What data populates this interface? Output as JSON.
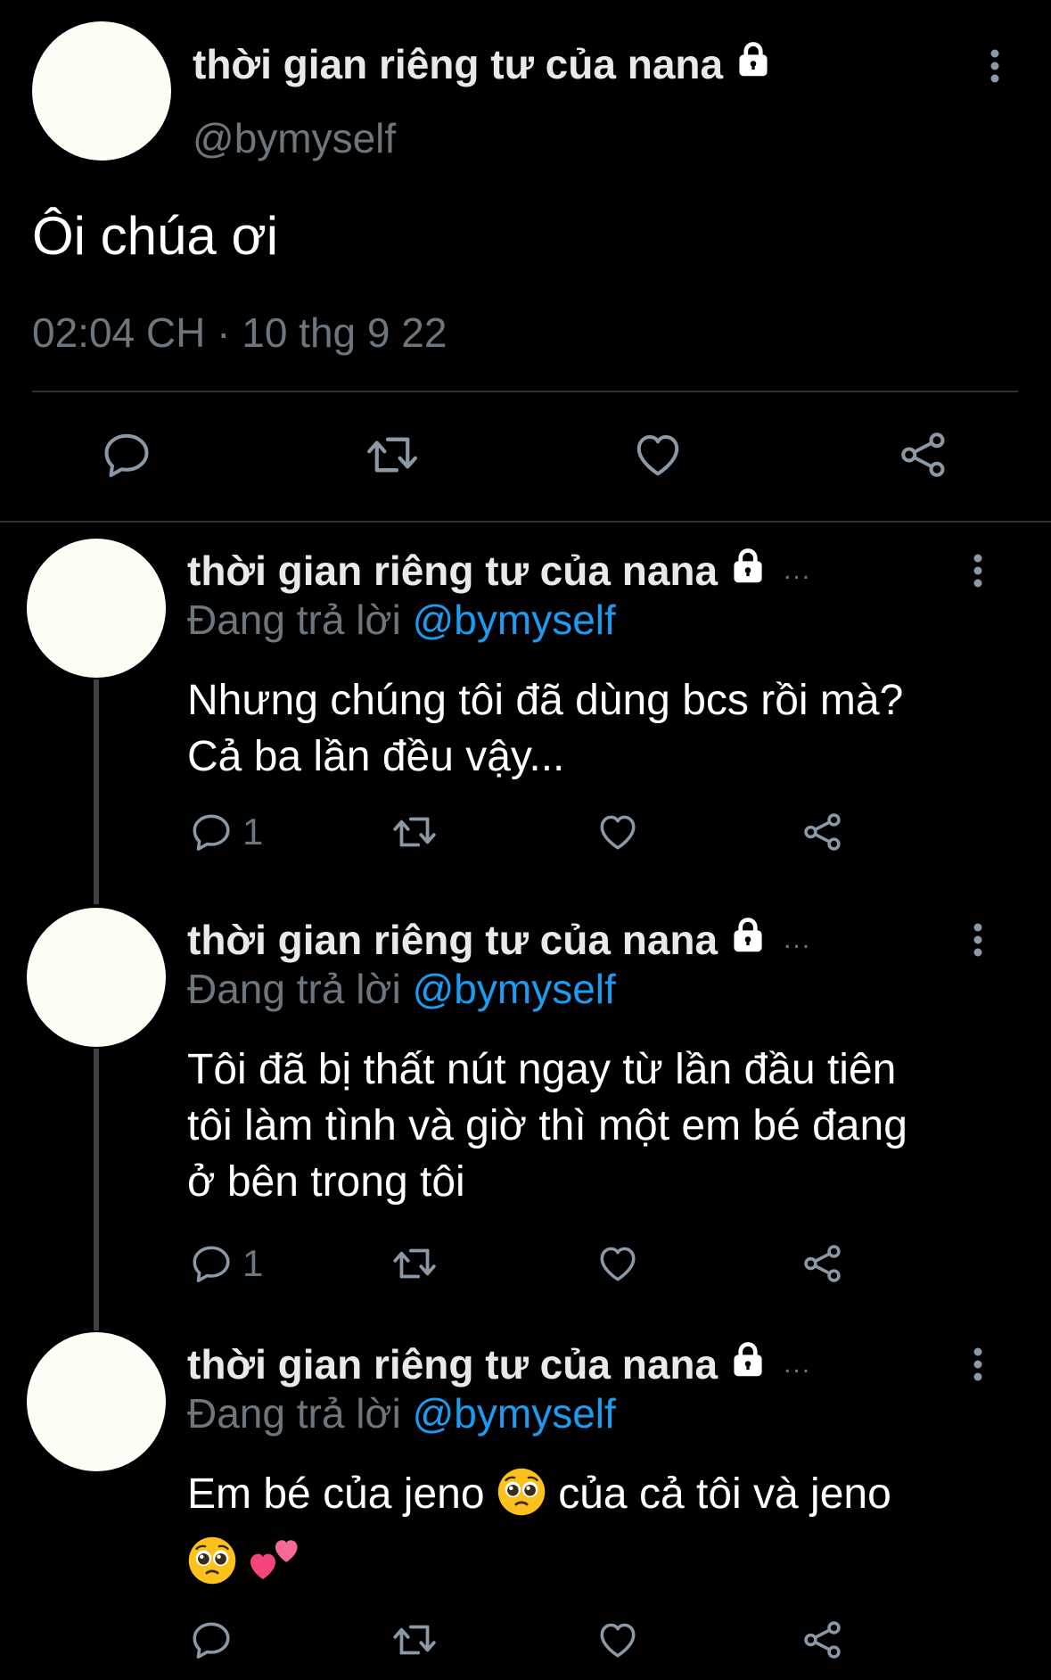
{
  "main_tweet": {
    "display_name": "thời gian riêng tư của nana",
    "handle": "@bymyself",
    "text": "Ôi chúa ơi",
    "time": "02:04 CH",
    "separator": "·",
    "date": "10 thg 9 22"
  },
  "replies": [
    {
      "display_name": "thời gian riêng tư của nana",
      "more_dots": "...",
      "replying_prefix": "Đang trả lời",
      "replying_to": "@bymyself",
      "text_lines": [
        "Nhưng chúng tôi đã dùng bcs rồi mà?",
        "Cả ba lần đều vậy..."
      ],
      "reply_count": "1"
    },
    {
      "display_name": "thời gian riêng tư của nana",
      "more_dots": "...",
      "replying_prefix": "Đang trả lời",
      "replying_to": "@bymyself",
      "text_lines": [
        "Tôi đã bị thất nút ngay từ lần đầu tiên",
        "tôi làm tình và giờ thì một em bé đang",
        "ở bên trong tôi"
      ],
      "reply_count": "1"
    },
    {
      "display_name": "thời gian riêng tư của nana",
      "more_dots": "...",
      "replying_prefix": "Đang trả lời",
      "replying_to": "@bymyself",
      "text_line1_a": "Em bé của jeno",
      "text_line1_b": "của cả tôi và jeno",
      "emojis": [
        "pleading-face-emoji",
        "pleading-face-emoji",
        "two-hearts-emoji"
      ]
    }
  ],
  "icons": [
    "lock-icon",
    "more-vertical-icon",
    "reply-icon",
    "retweet-icon",
    "like-icon",
    "share-icon"
  ],
  "colors": {
    "background": "#000000",
    "text": "#ffffff",
    "secondary": "#6e767d",
    "mention": "#1d9bf0",
    "divider": "#2f3336",
    "thread_line": "#3e4144",
    "avatar": "#fcfef5"
  }
}
